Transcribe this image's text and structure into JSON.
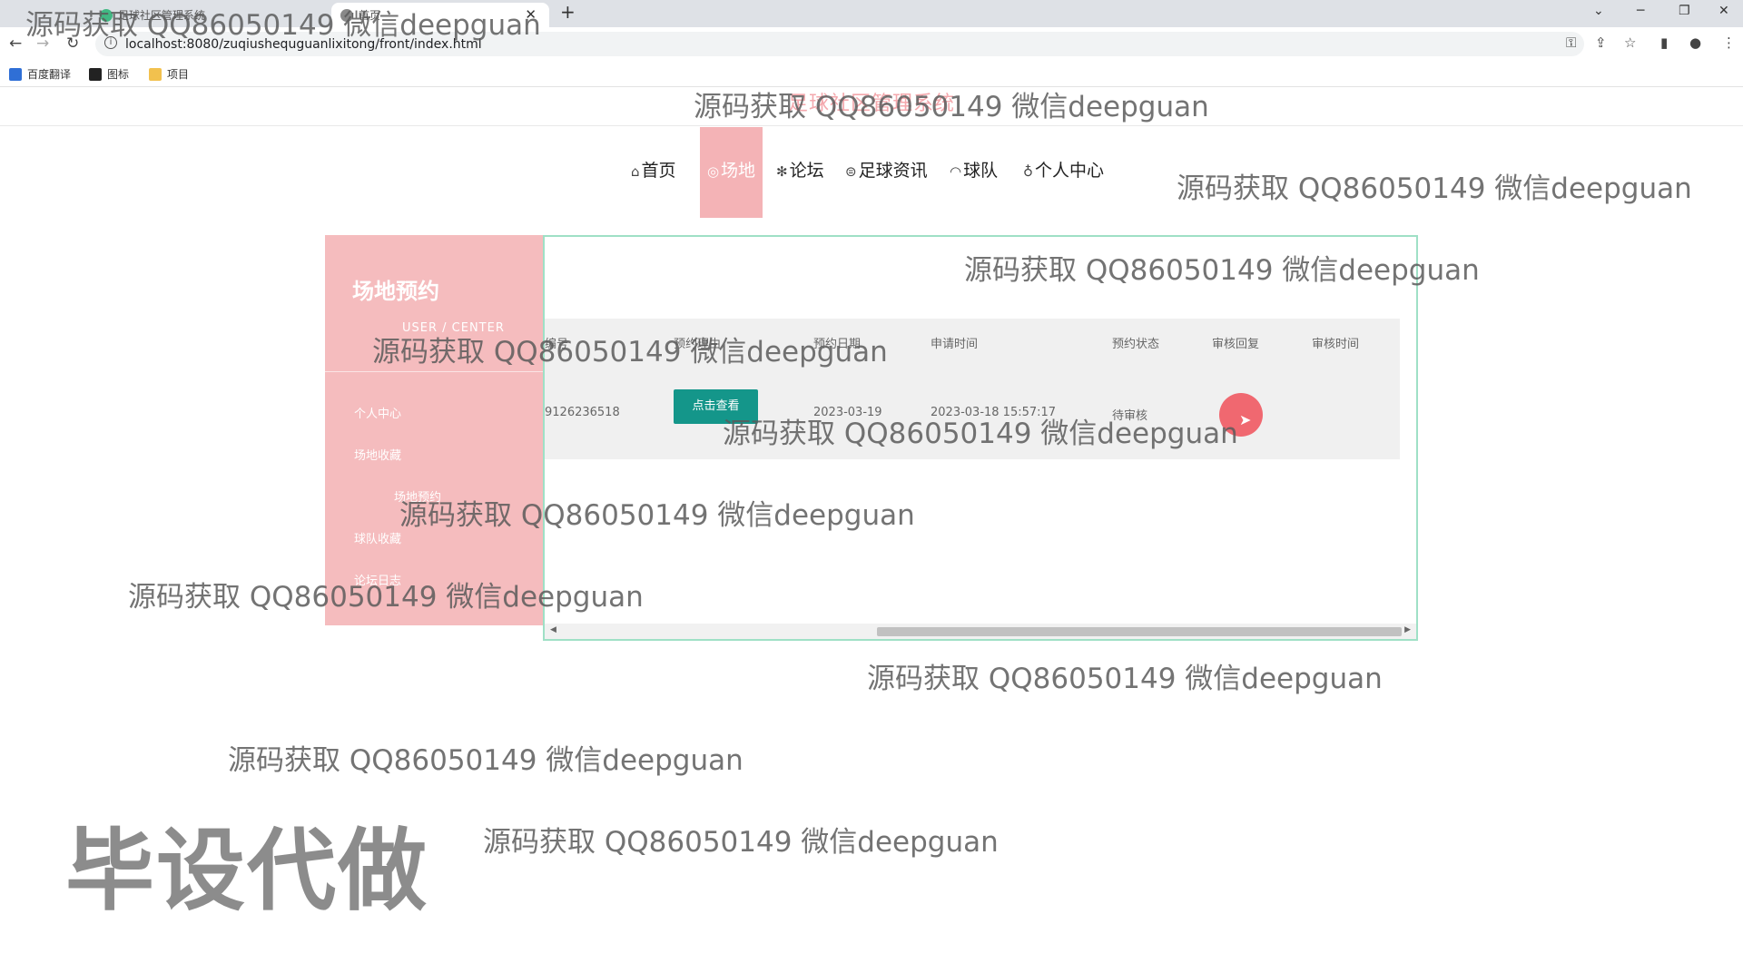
{
  "browser": {
    "tabs": [
      {
        "label": "足球社区管理系统"
      },
      {
        "label": "首页"
      }
    ],
    "url": "localhost:8080/zuqiushequguanlixitong/front/index.html",
    "bookmarks": [
      {
        "label": "百度翻译",
        "color": "#2f6fd6"
      },
      {
        "label": "图标",
        "color": "#222222"
      },
      {
        "label": "项目",
        "color": "#f2c14e"
      }
    ]
  },
  "site": {
    "title": "足球社区管理系统"
  },
  "nav": [
    {
      "icon": "home-icon",
      "glyph": "⌂",
      "label": "首页"
    },
    {
      "icon": "venue-icon",
      "glyph": "◎",
      "label": "场地"
    },
    {
      "icon": "forum-icon",
      "glyph": "✻",
      "label": "论坛"
    },
    {
      "icon": "news-icon",
      "glyph": "⊜",
      "label": "足球资讯"
    },
    {
      "icon": "team-icon",
      "glyph": "◠",
      "label": "球队"
    },
    {
      "icon": "user-icon",
      "glyph": "♁",
      "label": "个人中心"
    }
  ],
  "sidebar": {
    "title": "场地预约",
    "subtitle": "USER / CENTER",
    "items": [
      {
        "label": "个人中心"
      },
      {
        "label": "场地收藏"
      },
      {
        "label": "场地预约"
      },
      {
        "label": "球队收藏"
      },
      {
        "label": "论坛日志"
      }
    ]
  },
  "table": {
    "headers": [
      "编号",
      "预约理由",
      "预约日期",
      "申请时间",
      "预约状态",
      "审核回复",
      "审核时间"
    ],
    "rows": [
      {
        "id": "9126236518",
        "action": "点击查看",
        "date": "2023-03-19",
        "apply_time": "2023-03-18 15:57:17",
        "status": "待审核",
        "reply": "",
        "review_time": ""
      }
    ]
  },
  "watermark": {
    "text": "源码获取 QQ86050149 微信deepguan",
    "big": "毕设代做"
  },
  "colors": {
    "accent_pink": "#f4b3b6",
    "button_teal": "#14968a",
    "panel_border": "#9fe0c6"
  }
}
